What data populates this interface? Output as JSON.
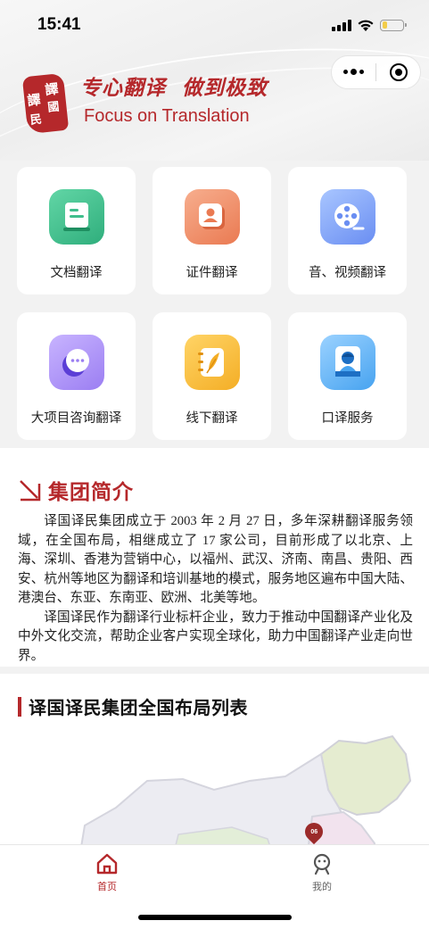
{
  "status_bar": {
    "time": "15:41",
    "battery_level": 0.25
  },
  "header": {
    "seal_chars": [
      "譯",
      "國",
      "譯",
      "民"
    ],
    "slogan_left": "专心翻译",
    "slogan_right": "做到极致",
    "slogan_en": "Focus on Translation"
  },
  "capsule": {
    "more_icon": "more-dots-icon",
    "close_icon": "target-circle-icon"
  },
  "services": [
    {
      "label": "文档翻译",
      "icon": "document-icon",
      "color": "#3fbe8c"
    },
    {
      "label": "证件翻译",
      "icon": "id-card-icon",
      "color": "#ee8a62"
    },
    {
      "label": "音、视频翻译",
      "icon": "video-reel-icon",
      "color": "#6b8ef0"
    },
    {
      "label": "大项目咨询翻译",
      "icon": "chat-bubble-icon",
      "color": "#9a7af0"
    },
    {
      "label": "线下翻译",
      "icon": "notebook-feather-icon",
      "color": "#f5b730"
    },
    {
      "label": "口译服务",
      "icon": "interpreter-icon",
      "color": "#4aa6f0"
    }
  ],
  "intro": {
    "title": "集团简介",
    "paragraph1": "译国译民集团成立于 2003 年 2 月 27 日，多年深耕翻译服务领域，在全国布局，相继成立了 17 家公司，目前形成了以北京、上海、深圳、香港为营销中心，以福州、武汉、济南、南昌、贵阳、西安、杭州等地区为翻译和培训基地的模式，服务地区遍布中国大陆、港澳台、东亚、东南亚、欧洲、北美等地。",
    "paragraph2": "译国译民作为翻译行业标杆企业，致力于推动中国翻译产业化及中外文化交流，帮助企业客户实现全球化，助力中国翻译产业走向世界。"
  },
  "layout_section": {
    "title": "译国译民集团全国布局列表",
    "map_pin_label": "06"
  },
  "tabbar": {
    "tabs": [
      {
        "label": "首页",
        "icon": "home-icon",
        "active": true
      },
      {
        "label": "我的",
        "icon": "profile-icon",
        "active": false
      }
    ],
    "active_color": "#b5282b",
    "inactive_color": "#666666"
  }
}
